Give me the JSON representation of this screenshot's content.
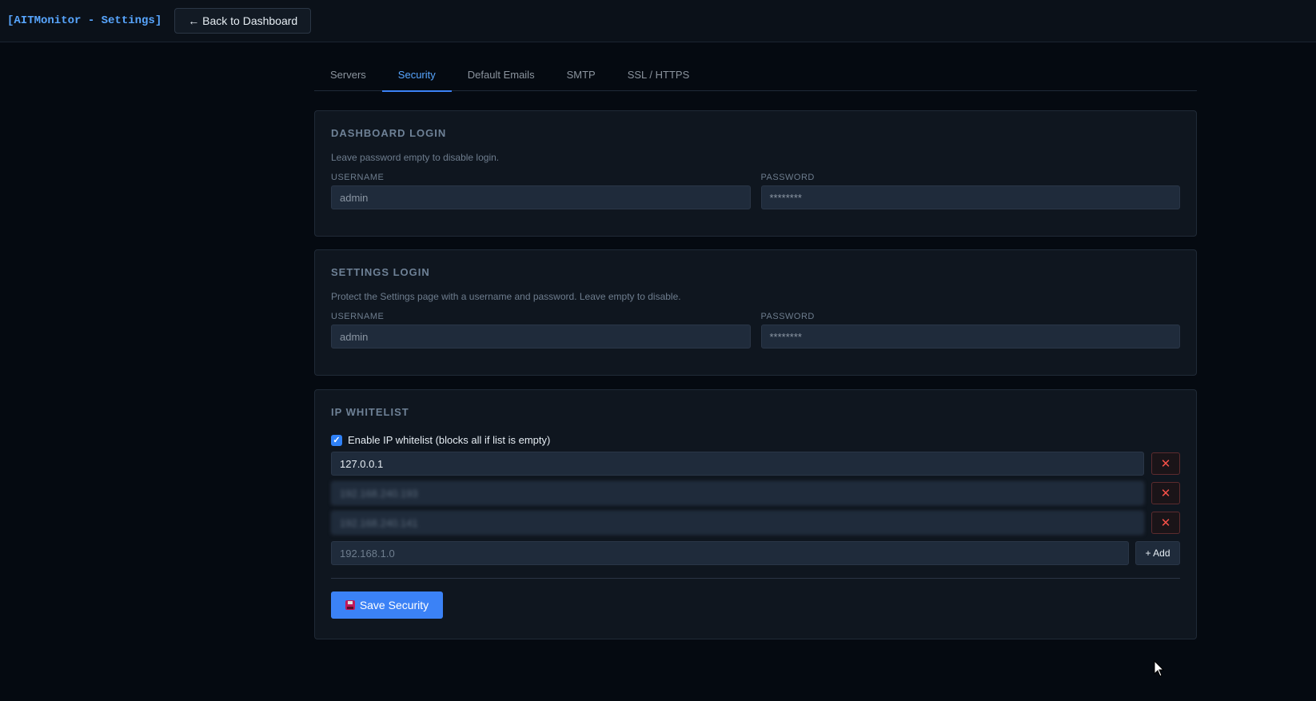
{
  "header": {
    "app_title": "[AITMonitor - Settings]",
    "back_label": "← Back to Dashboard"
  },
  "tabs": [
    {
      "label": "Servers"
    },
    {
      "label": "Security",
      "active": true
    },
    {
      "label": "Default Emails"
    },
    {
      "label": "SMTP"
    },
    {
      "label": "SSL / HTTPS"
    }
  ],
  "dashboard_login": {
    "title": "DASHBOARD LOGIN",
    "description": "Leave password empty to disable login.",
    "username_label": "USERNAME",
    "username_value": "admin",
    "password_label": "PASSWORD",
    "password_value": "********"
  },
  "settings_login": {
    "title": "SETTINGS LOGIN",
    "description": "Protect the Settings page with a username and password. Leave empty to disable.",
    "username_label": "USERNAME",
    "username_value": "admin",
    "password_label": "PASSWORD",
    "password_value": "********"
  },
  "ip_whitelist": {
    "title": "IP WHITELIST",
    "enable_label": "Enable IP whitelist (blocks all if list is empty)",
    "enabled": true,
    "entries": [
      "127.0.0.1",
      "192.168.240.193",
      "192.168.240.141"
    ],
    "new_placeholder": "192.168.1.0",
    "add_label": "+ Add",
    "save_label": "Save Security"
  },
  "colors": {
    "accent": "#3b82f6",
    "danger": "#f85149",
    "background": "#050a11"
  }
}
